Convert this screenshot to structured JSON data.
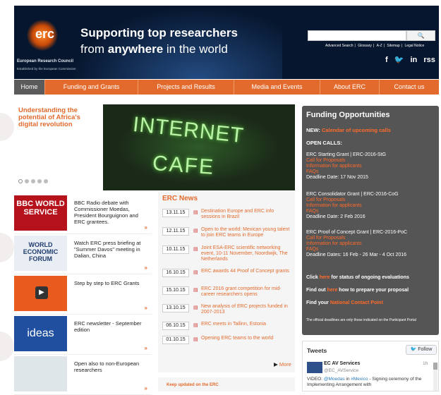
{
  "header": {
    "logo": "erc",
    "logo_sub": "European Research Council",
    "logo_sub2": "Established by the European Commission",
    "tagline1": "Supporting top researchers",
    "tagline2_pre": "from ",
    "tagline2_bold": "anywhere",
    "tagline2_post": " in the world",
    "search_button": "🔍",
    "top_links": [
      "Advanced Search",
      "|",
      "Glossary",
      "|",
      "A-Z",
      "|",
      "Sitemap",
      "|",
      "Legal Notice"
    ],
    "social": [
      "f",
      "🐦",
      "in",
      "rss"
    ]
  },
  "nav": [
    {
      "label": "Home",
      "w": 44
    },
    {
      "label": "Funding and Grants",
      "w": 132
    },
    {
      "label": "Projects and Results",
      "w": 136
    },
    {
      "label": "Media and Events",
      "w": 122
    },
    {
      "label": "About ERC",
      "w": 84
    },
    {
      "label": "Contact us",
      "w": 84
    }
  ],
  "hero": {
    "text": "Understanding the potential of Africa's digital revolution",
    "sign_line1": "INTERNET",
    "sign_line2": "CAFE"
  },
  "news": [
    {
      "text": "BBC Radio debate with Commissioner Moedas, President Bourguignon and ERC grantees.",
      "thumb": "BBC WORLD SERVICE"
    },
    {
      "text": "Watch ERC press briefing at \"Summer Davos\" meeting in Dalian, China",
      "thumb": "WORLD ECONOMIC FORUM"
    },
    {
      "text": "Step by step to ERC Grants",
      "thumb": ""
    },
    {
      "text": "ERC newsletter - September edition",
      "thumb": "ideas"
    },
    {
      "text": "Open also to non-European researchers",
      "thumb": ""
    }
  ],
  "erc_news": {
    "title": "ERC News",
    "items": [
      {
        "date": "13.11.15",
        "text": "Destination Europe and ERC info sessions in Brazil"
      },
      {
        "date": "12.11.15",
        "text": "Open to the world: Mexican young talent to join ERC teams in Europe"
      },
      {
        "date": "10.11.15",
        "text": "Joint ESA-ERC scientific networking event, 10-11 November, Noordwijk, The Netherlands"
      },
      {
        "date": "16.10.15",
        "text": "ERC awards 44 Proof of Concept grants"
      },
      {
        "date": "15.10.15",
        "text": "ERC 2016 grant competition for mid-career researchers opens"
      },
      {
        "date": "13.10.15",
        "text": "New analysis of ERC projects funded in 2007-2013"
      },
      {
        "date": "06.10.15",
        "text": "ERC meets in Tallinn, Estonia"
      },
      {
        "date": "01.10.15",
        "text": "Opening ERC teams to the world"
      }
    ],
    "more": "More",
    "keep": "Keep updated on the ERC"
  },
  "funding": {
    "title": "Funding Opportunities",
    "new_label": "NEW: ",
    "new_link": "Calendar of upcoming calls",
    "open_calls": "OPEN CALLS:",
    "grants": [
      {
        "title": "ERC Starting Grant | ERC-2016-StG",
        "links": [
          "Call for Proposals",
          "Information for applicants",
          "FAQs"
        ],
        "deadline": "Deadline Date: 17 Nov 2015"
      },
      {
        "title": "ERC Consolidator Grant | ERC-2016-CoG",
        "links": [
          "Call for Proposals",
          "Information for applicants",
          "FAQs"
        ],
        "deadline": "Deadline Date: 2 Feb 2016"
      },
      {
        "title": "ERC Proof of Concept Grant | ERC-2016-PoC",
        "links": [
          "Call for Proposals",
          "Information for applicants",
          "FAQs"
        ],
        "deadline": "Deadline Dates: 16 Feb - 26 Mar - 4 Oct 2016"
      }
    ],
    "click1_pre": "Click ",
    "click1_link": "here",
    "click1_post": " for status of ongoing evaluations",
    "click2_pre": "Find out ",
    "click2_link": "here",
    "click2_post": " how to prepare your proposal",
    "click3_pre": "Find your ",
    "click3_link": "National Contact Point",
    "note": "The official deadlines are only those indicated on the Participant Portal"
  },
  "tweets": {
    "title": "Tweets",
    "follow": "Follow",
    "name": "EC AV Services",
    "handle": "@EC_AVService",
    "time": "1h",
    "text_pre": "VIDEO: ",
    "text_h1": "@Moedas",
    "text_mid": " in ",
    "text_h2": "#Mexico",
    "text_post": " - Signing ceremony of the Implementing Arrangement with"
  }
}
